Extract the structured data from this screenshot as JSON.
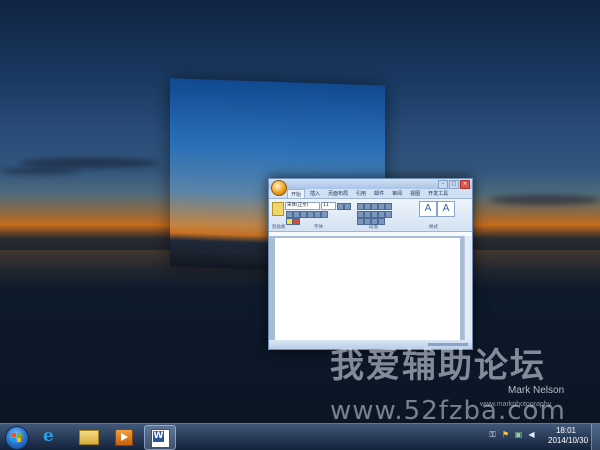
{
  "word_window": {
    "tabs": [
      "开始",
      "插入",
      "页面布局",
      "引用",
      "邮件",
      "审阅",
      "视图",
      "开发工具"
    ],
    "font_name": "宋体(正文)",
    "font_size": "11",
    "group_labels": [
      "剪贴板",
      "字体",
      "段落",
      "样式"
    ]
  },
  "watermark": {
    "chinese": "我爱辅助论坛",
    "author": "Mark Nelson",
    "photo_credit": "www.markphotography",
    "url": "www.52fzba.com"
  },
  "taskbar": {
    "clock_time": "18:01",
    "clock_date": "2014/10/30"
  }
}
